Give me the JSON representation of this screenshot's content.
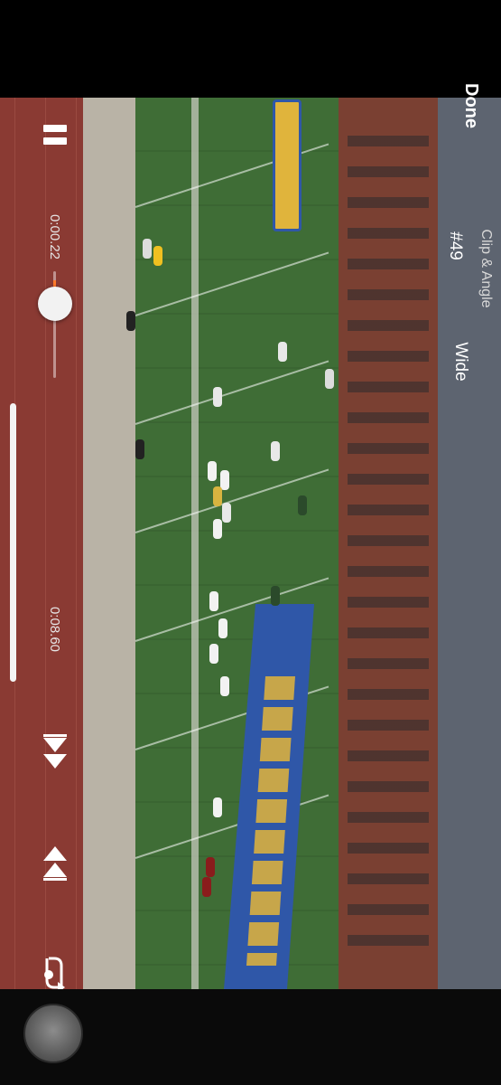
{
  "header": {
    "done_label": "Done",
    "clip_label": "Clip & Angle",
    "clip_number": "#49",
    "angle": "Wide"
  },
  "playback": {
    "current_time": "0:00.22",
    "total_time": "0:08.60",
    "progress": 0.026
  },
  "icons": {
    "pause": "pause-icon",
    "skip_back": "skip-back-icon",
    "skip_forward": "skip-forward-icon",
    "loop": "loop-icon",
    "record": "record-icon"
  },
  "colors": {
    "accent": "#ff7a2a",
    "background": "#000000"
  }
}
